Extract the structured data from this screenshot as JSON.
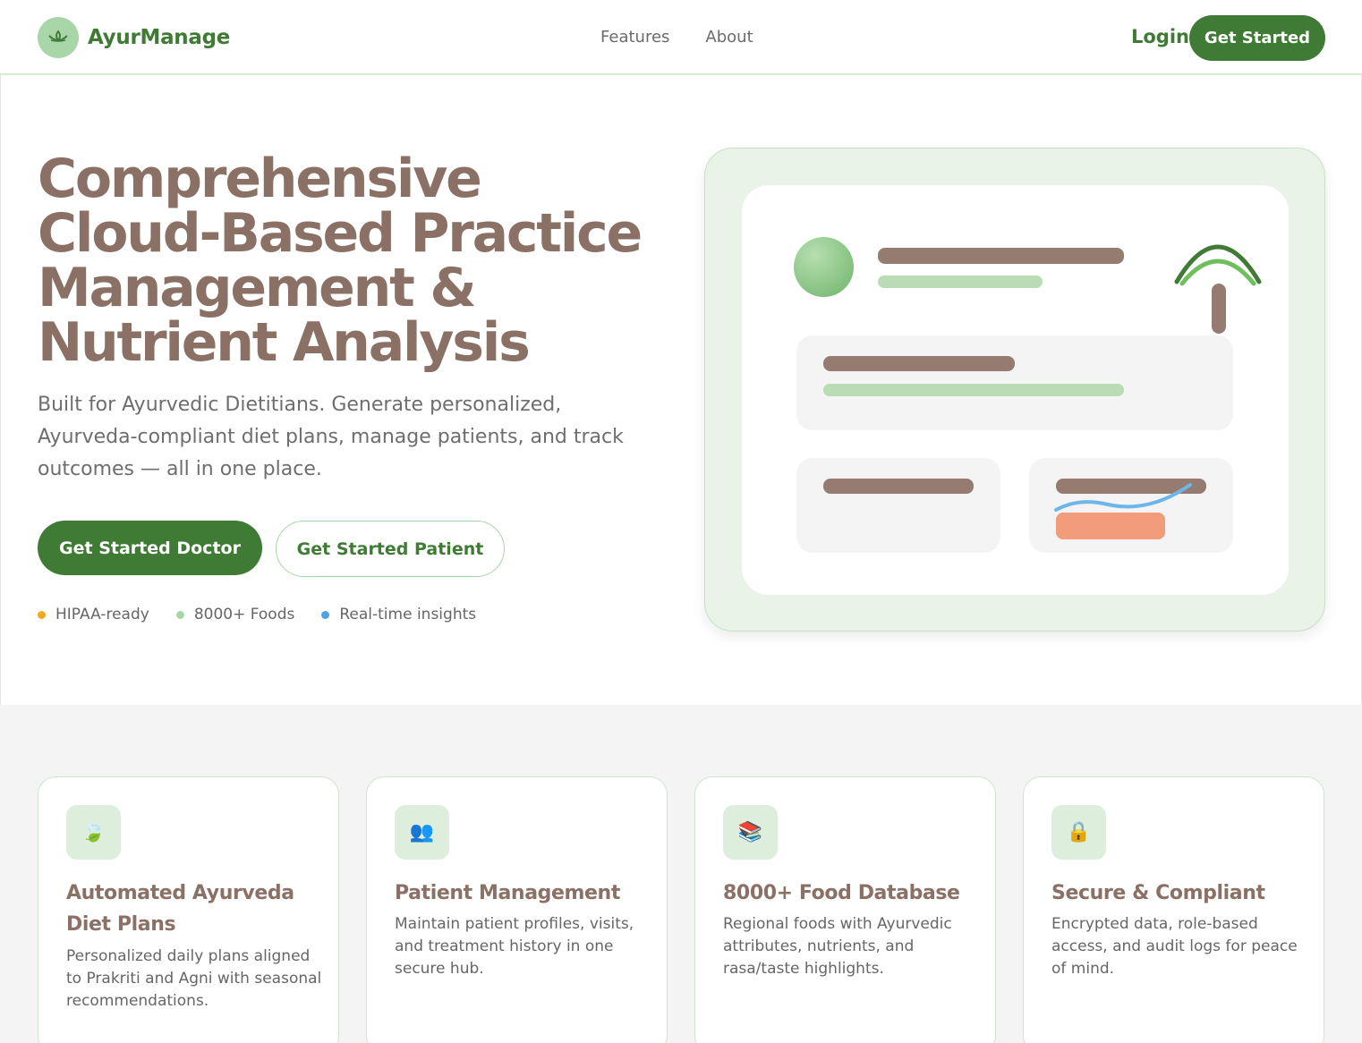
{
  "header": {
    "brand": "AyurManage",
    "nav": [
      "Features",
      "About"
    ],
    "login_label": "Login",
    "get_started_label": "Get Started"
  },
  "hero": {
    "title_lines": [
      "Comprehensive",
      "Cloud-Based Practice",
      "Management &",
      "Nutrient Analysis"
    ],
    "subtitle": "Built for Ayurvedic Dietitians. Generate personalized, Ayurveda-compliant diet plans, manage patients, and track outcomes — all in one place.",
    "doctor_button": "Get Started Doctor",
    "patient_button": "Get Started Patient",
    "badges": [
      {
        "label": "HIPAA-ready",
        "color": "#f5a623"
      },
      {
        "label": "8000+ Foods",
        "color": "#a9d6a9"
      },
      {
        "label": "Real-time insights",
        "color": "#4aa3e8"
      }
    ]
  },
  "features": [
    {
      "icon": "leaf-icon",
      "title": "Automated Ayurveda Diet Plans",
      "desc": "Personalized daily plans aligned to Prakriti and Agni with seasonal recommendations."
    },
    {
      "icon": "users-icon",
      "title": "Patient Management",
      "desc": "Maintain patient profiles, visits, and treatment history in one secure hub."
    },
    {
      "icon": "books-icon",
      "title": "8000+ Food Database",
      "desc": "Regional foods with Ayurvedic attributes, nutrients, and rasa/taste highlights."
    },
    {
      "icon": "lock-icon",
      "title": "Secure & Compliant",
      "desc": "Encrypted data, role-based access, and audit logs for peace of mind."
    }
  ],
  "colors": {
    "primary_green": "#3f7b35",
    "brown": "#8b7065",
    "light_green": "#a9d6a9"
  }
}
